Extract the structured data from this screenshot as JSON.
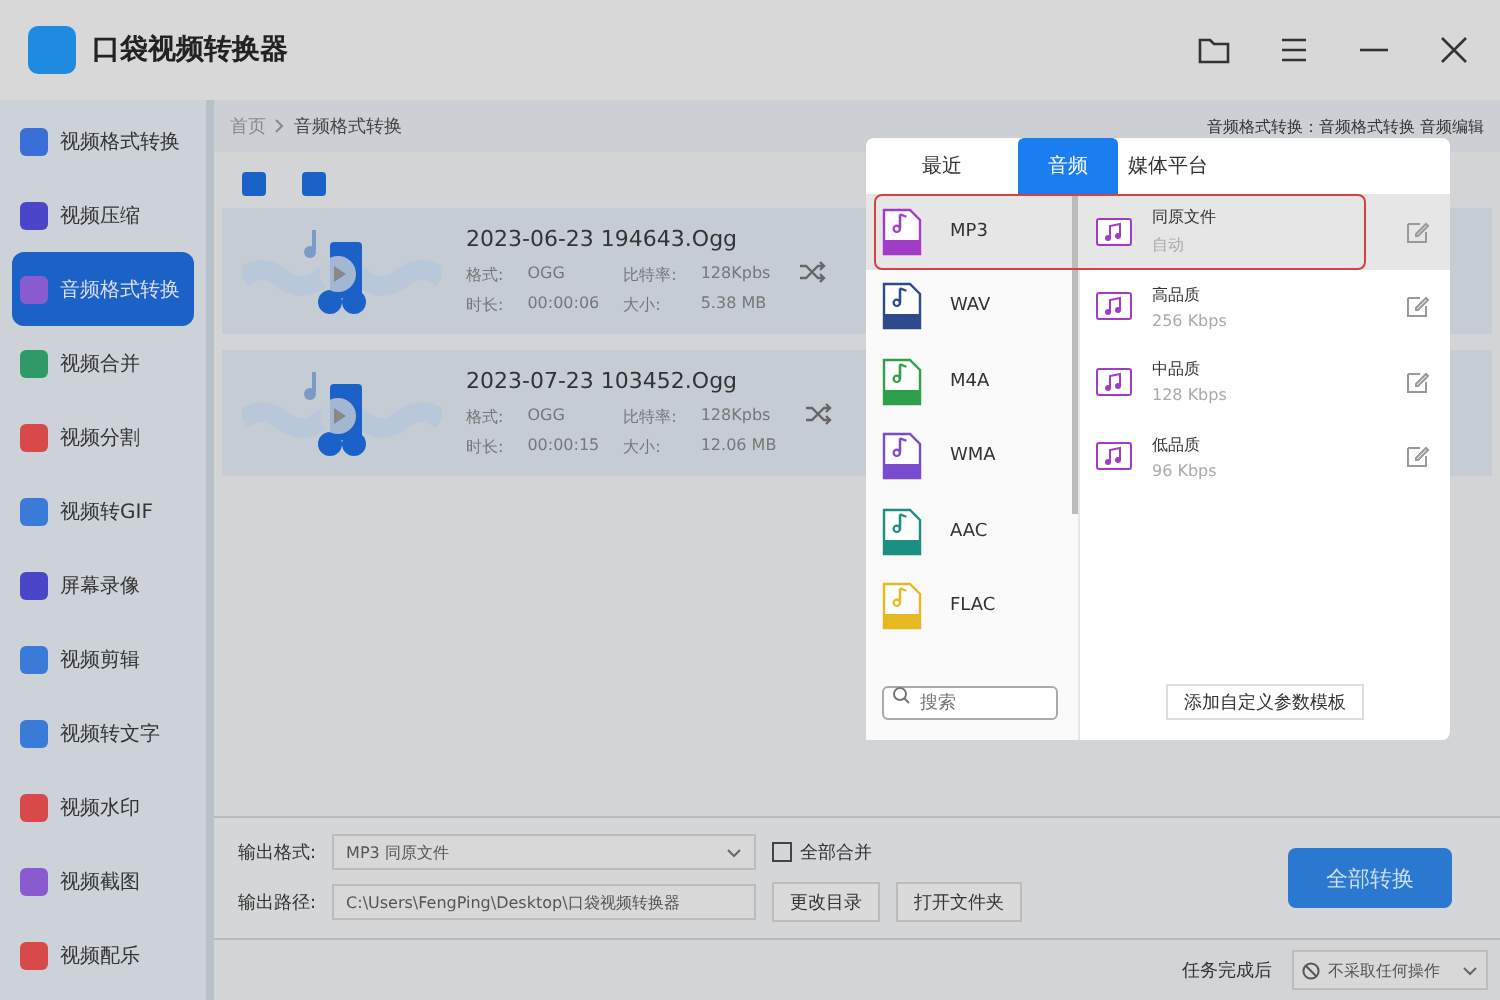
{
  "window": {
    "title": "口袋视频转换器"
  },
  "sidebar": {
    "items": [
      {
        "label": "视频格式转换",
        "selected": false,
        "color": "#3a6fd8"
      },
      {
        "label": "视频压缩",
        "selected": false,
        "color": "#4a46c8"
      },
      {
        "label": "音频格式转换",
        "selected": true,
        "color": "#8a5ad0"
      },
      {
        "label": "视频合并",
        "selected": false,
        "color": "#2e9a68"
      },
      {
        "label": "视频分割",
        "selected": false,
        "color": "#d84a4a"
      },
      {
        "label": "视频转GIF",
        "selected": false,
        "color": "#3a7ad8"
      },
      {
        "label": "屏幕录像",
        "selected": false,
        "color": "#4a46c8"
      },
      {
        "label": "视频剪辑",
        "selected": false,
        "color": "#3a7ad8"
      },
      {
        "label": "视频转文字",
        "selected": false,
        "color": "#3a7ad8"
      },
      {
        "label": "视频水印",
        "selected": false,
        "color": "#d84a4a"
      },
      {
        "label": "视频截图",
        "selected": false,
        "color": "#8a5ad0"
      },
      {
        "label": "视频配乐",
        "selected": false,
        "color": "#d84a4a"
      }
    ]
  },
  "breadcrumb": [
    "首页",
    "音频格式转换"
  ],
  "header_links": "音频格式转换：音频格式转换 音频编辑",
  "files": [
    {
      "name": "2023-06-23 194643.Ogg",
      "format_label": "格式:",
      "format": "OGG",
      "bitrate_label": "比特率:",
      "bitrate": "128Kpbs",
      "duration_label": "时长:",
      "duration": "00:00:06",
      "size_label": "大小:",
      "size": "5.38 MB"
    },
    {
      "name": "2023-07-23 103452.Ogg",
      "format_label": "格式:",
      "format": "OGG",
      "bitrate_label": "比特率:",
      "bitrate": "128Kpbs",
      "duration_label": "时长:",
      "duration": "00:00:15",
      "size_label": "大小:",
      "size": "12.06 MB"
    }
  ],
  "output": {
    "format_label": "输出格式:",
    "format_value": "MP3  同原文件",
    "merge_label": "全部合并",
    "merge_checked": false,
    "path_label": "输出路径:",
    "path_value": "C:\\Users\\FengPing\\Desktop\\口袋视频转换器",
    "change_dir": "更改目录",
    "open_folder": "打开文件夹",
    "convert_all": "全部转换"
  },
  "footer": {
    "label": "任务完成后",
    "action": "不采取任何操作"
  },
  "popup": {
    "tabs": [
      {
        "label": "最近",
        "selected": false
      },
      {
        "label": "音频",
        "selected": true
      },
      {
        "label": "媒体平台",
        "selected": false
      }
    ],
    "formats": [
      {
        "name": "MP3",
        "selected": true,
        "color": "#a23cc8"
      },
      {
        "name": "WAV",
        "selected": false,
        "color": "#2c4a8c"
      },
      {
        "name": "M4A",
        "selected": false,
        "color": "#2ea04a"
      },
      {
        "name": "WMA",
        "selected": false,
        "color": "#7a4ad0"
      },
      {
        "name": "AAC",
        "selected": false,
        "color": "#1a9080"
      },
      {
        "name": "FLAC",
        "selected": false,
        "color": "#e8b820"
      }
    ],
    "search_placeholder": "搜索",
    "presets": [
      {
        "title": "同原文件",
        "detail": "自动",
        "selected": true
      },
      {
        "title": "高品质",
        "detail": "256 Kbps",
        "selected": false
      },
      {
        "title": "中品质",
        "detail": "128 Kbps",
        "selected": false
      },
      {
        "title": "低品质",
        "detail": "96 Kbps",
        "selected": false
      }
    ],
    "add_template": "添加自定义参数模板"
  }
}
